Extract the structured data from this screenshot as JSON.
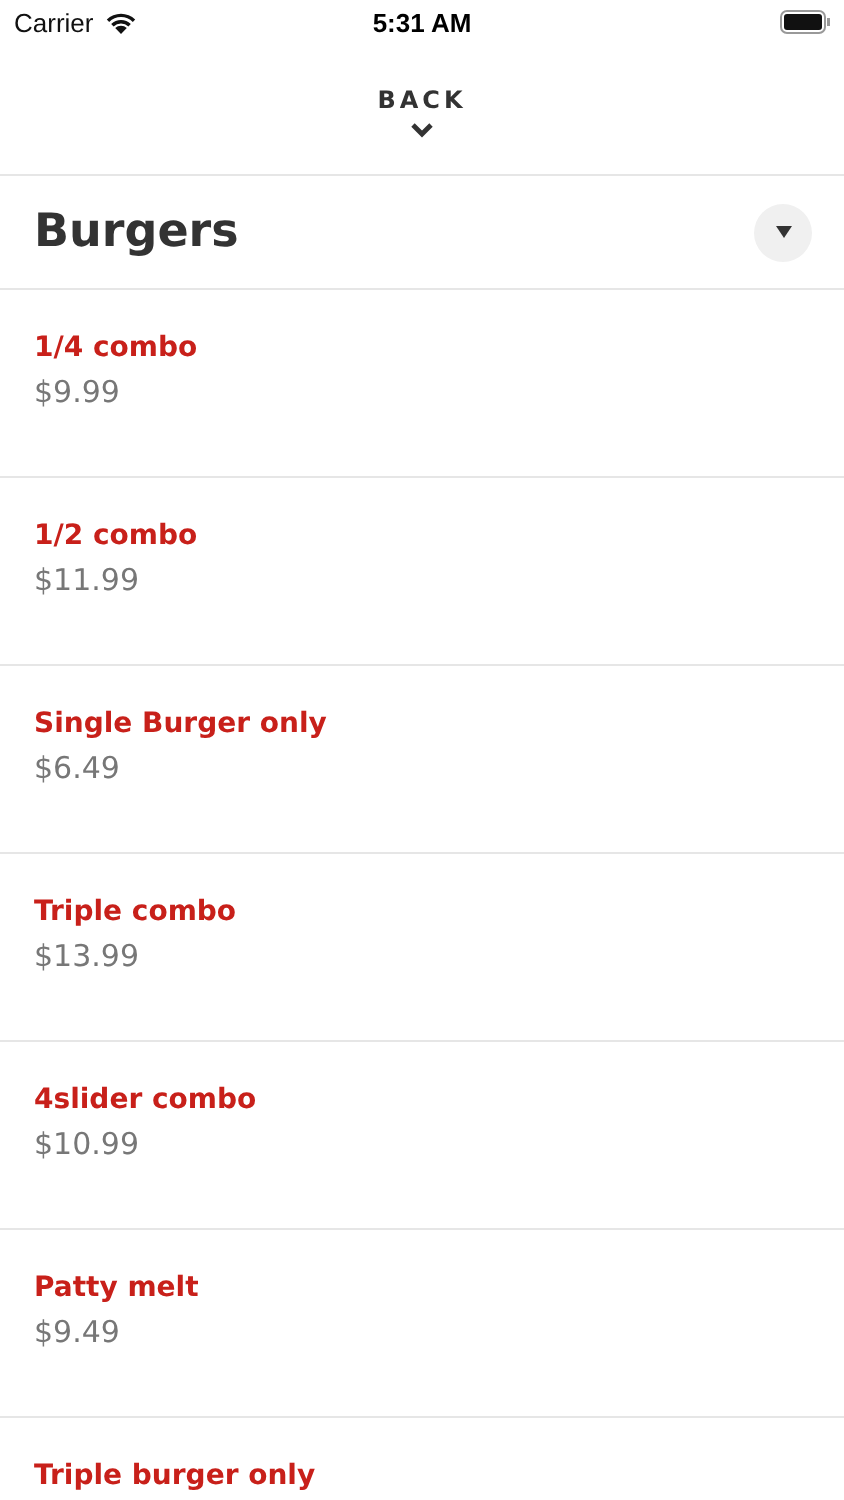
{
  "status_bar": {
    "carrier": "Carrier",
    "time": "5:31 AM"
  },
  "back": {
    "label": "BACK"
  },
  "category": {
    "title": "Burgers"
  },
  "items": [
    {
      "name": "1/4 combo",
      "price": "$9.99"
    },
    {
      "name": "1/2 combo",
      "price": "$11.99"
    },
    {
      "name": "Single Burger only",
      "price": "$6.49"
    },
    {
      "name": "Triple combo",
      "price": "$13.99"
    },
    {
      "name": "4slider combo",
      "price": "$10.99"
    },
    {
      "name": "Patty melt",
      "price": "$9.49"
    },
    {
      "name": "Triple burger only"
    }
  ]
}
